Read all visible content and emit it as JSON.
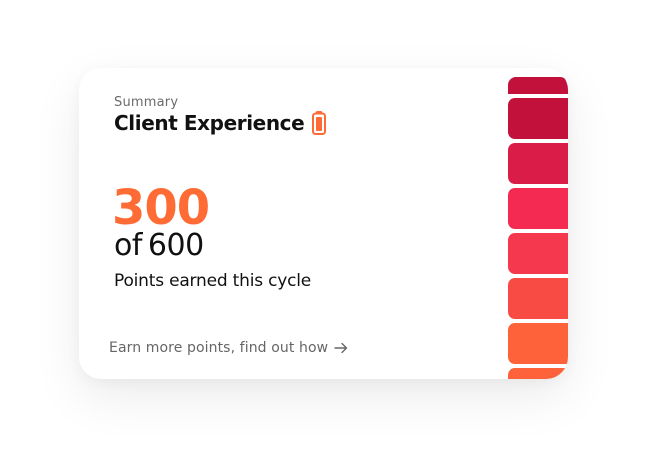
{
  "card": {
    "eyebrow": "Summary",
    "title": "Client Experience",
    "title_icon": "battery-icon",
    "points_earned": "300",
    "total_prefix": "of",
    "total_points": "600",
    "caption": "Points earned this cycle",
    "link_text": "Earn more points, find out how",
    "link_icon": "arrow-right-icon"
  },
  "colors": {
    "accent": "#ff6b35",
    "text": "#111111",
    "muted": "#666666",
    "bars": [
      "#c2113a",
      "#c2113a",
      "#d91d48",
      "#f52a52",
      "#f5384d",
      "#f84b44",
      "#fd623b",
      "#fd623b"
    ]
  }
}
